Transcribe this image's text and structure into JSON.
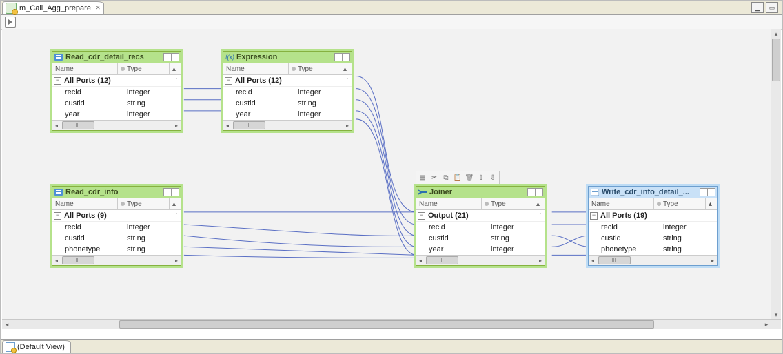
{
  "tab_title": "m_Call_Agg_prepare",
  "footer_tab": "(Default View)",
  "columns": {
    "name": "Name",
    "type": "Type"
  },
  "mini_toolbar": [
    "new",
    "cut",
    "copy",
    "paste",
    "delete",
    "undo",
    "redo",
    "link"
  ],
  "nodes": {
    "read_detail": {
      "title": "Read_cdr_detail_recs",
      "group": "All Ports (12)",
      "ports": [
        {
          "name": "recid",
          "type": "integer"
        },
        {
          "name": "custid",
          "type": "string"
        },
        {
          "name": "year",
          "type": "integer"
        }
      ]
    },
    "expression": {
      "title": "Expression",
      "group": "All Ports (12)",
      "ports": [
        {
          "name": "recid",
          "type": "integer"
        },
        {
          "name": "custid",
          "type": "string"
        },
        {
          "name": "year",
          "type": "integer"
        }
      ]
    },
    "read_info": {
      "title": "Read_cdr_info",
      "group": "All Ports (9)",
      "ports": [
        {
          "name": "recid",
          "type": "integer"
        },
        {
          "name": "custid",
          "type": "string"
        },
        {
          "name": "phonetype",
          "type": "string"
        }
      ]
    },
    "joiner": {
      "title": "Joiner",
      "group": "Output (21)",
      "ports": [
        {
          "name": "recid",
          "type": "integer"
        },
        {
          "name": "custid",
          "type": "string"
        },
        {
          "name": "year",
          "type": "integer"
        }
      ]
    },
    "write": {
      "title": "Write_cdr_info_detail_...",
      "group": "All Ports (19)",
      "ports": [
        {
          "name": "recid",
          "type": "integer"
        },
        {
          "name": "custid",
          "type": "string"
        },
        {
          "name": "phonetype",
          "type": "string"
        }
      ]
    }
  }
}
